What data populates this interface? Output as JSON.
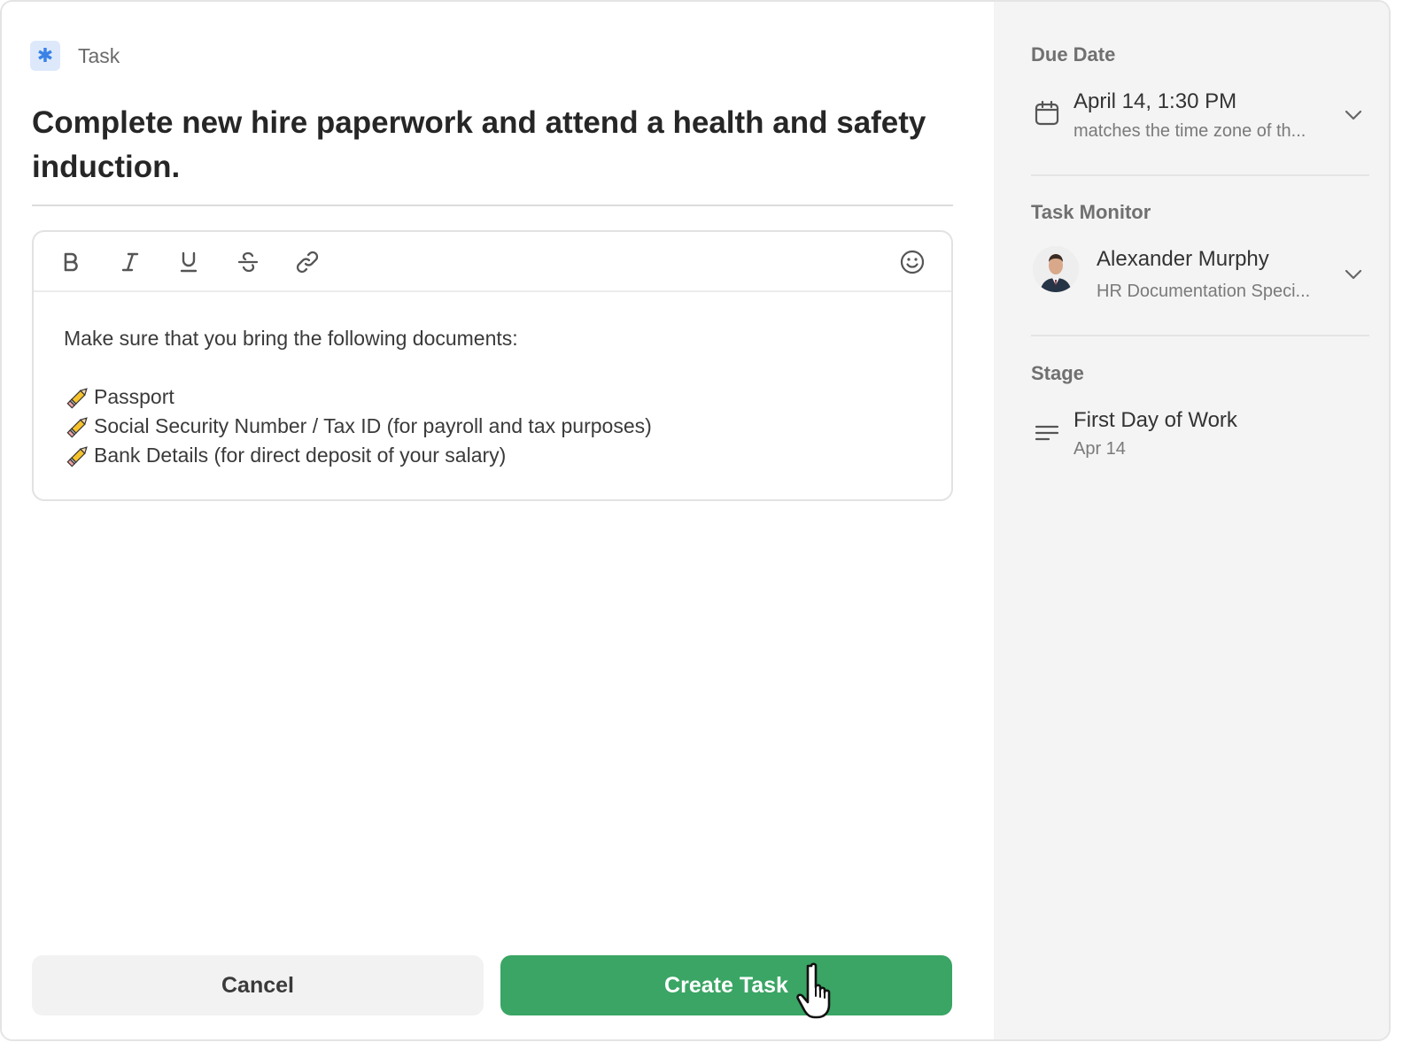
{
  "header": {
    "type_icon": "asterisk-icon",
    "type_label": "Task",
    "title": "Complete new hire paperwork and attend a health and safety induction."
  },
  "editor": {
    "toolbar": [
      "bold-icon",
      "italic-icon",
      "underline-icon",
      "strikethrough-icon",
      "link-icon",
      "emoji-icon"
    ],
    "intro": "Make sure that you bring the following documents:",
    "items": [
      "Passport",
      "Social Security Number / Tax ID (for payroll and tax purposes)",
      "Bank Details (for direct deposit of your salary)"
    ],
    "item_icon": "pencil-icon"
  },
  "actions": {
    "cancel_label": "Cancel",
    "create_label": "Create Task"
  },
  "sidebar": {
    "due_date": {
      "label": "Due Date",
      "value": "April 14, 1:30 PM",
      "note": "matches the time zone of th...",
      "icon": "calendar-icon"
    },
    "task_monitor": {
      "label": "Task Monitor",
      "name": "Alexander Murphy",
      "role": "HR Documentation Speci..."
    },
    "stage": {
      "label": "Stage",
      "name": "First Day of Work",
      "date": "Apr 14",
      "icon": "lines-icon"
    }
  },
  "colors": {
    "accent_green": "#3aa564",
    "accent_blue": "#3a82e6"
  }
}
